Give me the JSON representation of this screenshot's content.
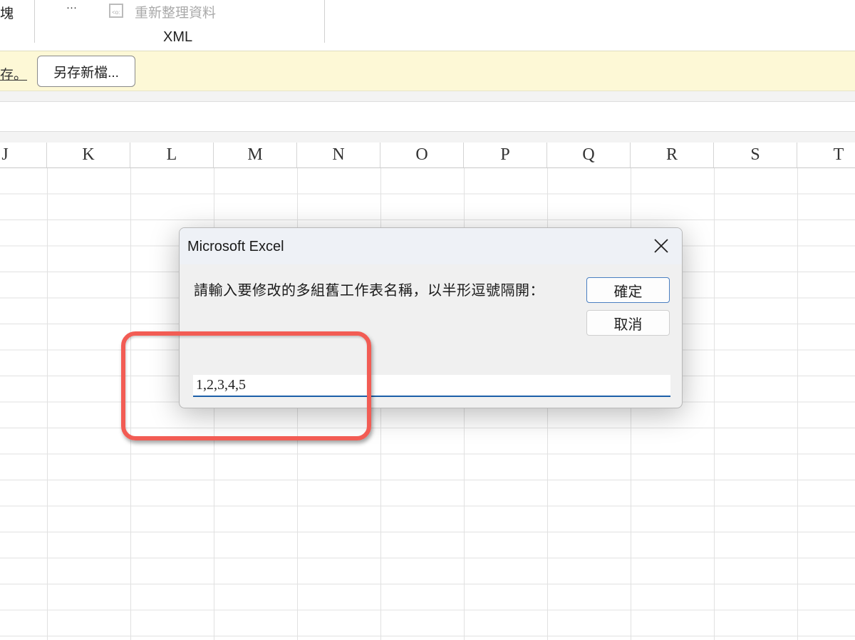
{
  "ribbon": {
    "partial_left_label": "塊",
    "ellipsis": "···",
    "refresh_data": "重新整理資料",
    "group_label": "XML"
  },
  "message_bar": {
    "partial_text": "存。",
    "save_as_button": "另存新檔..."
  },
  "columns": [
    "J",
    "K",
    "L",
    "M",
    "N",
    "O",
    "P",
    "Q",
    "R",
    "S",
    "T"
  ],
  "dialog": {
    "title": "Microsoft Excel",
    "prompt": "請輸入要修改的多組舊工作表名稱，以半形逗號隔開：",
    "ok_button": "確定",
    "cancel_button": "取消",
    "input_value": "1,2,3,4,5"
  },
  "colors": {
    "highlight": "#f25c54",
    "accent": "#1c5fa8"
  }
}
